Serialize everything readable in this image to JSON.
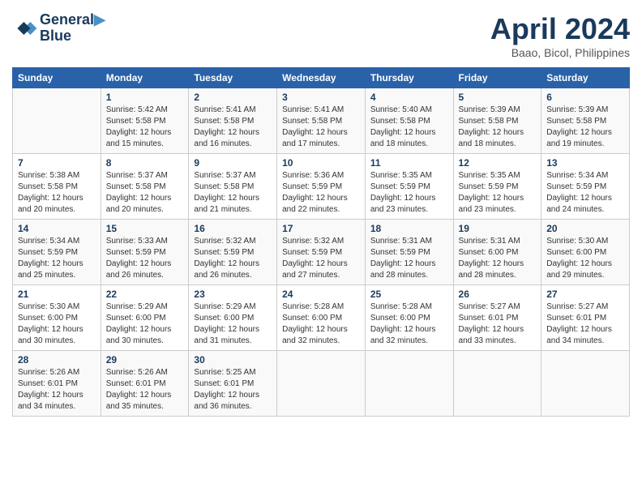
{
  "header": {
    "logo_line1": "General",
    "logo_line2": "Blue",
    "month_title": "April 2024",
    "location": "Baao, Bicol, Philippines"
  },
  "days_of_week": [
    "Sunday",
    "Monday",
    "Tuesday",
    "Wednesday",
    "Thursday",
    "Friday",
    "Saturday"
  ],
  "weeks": [
    [
      {
        "day": "",
        "info": ""
      },
      {
        "day": "1",
        "info": "Sunrise: 5:42 AM\nSunset: 5:58 PM\nDaylight: 12 hours\nand 15 minutes."
      },
      {
        "day": "2",
        "info": "Sunrise: 5:41 AM\nSunset: 5:58 PM\nDaylight: 12 hours\nand 16 minutes."
      },
      {
        "day": "3",
        "info": "Sunrise: 5:41 AM\nSunset: 5:58 PM\nDaylight: 12 hours\nand 17 minutes."
      },
      {
        "day": "4",
        "info": "Sunrise: 5:40 AM\nSunset: 5:58 PM\nDaylight: 12 hours\nand 18 minutes."
      },
      {
        "day": "5",
        "info": "Sunrise: 5:39 AM\nSunset: 5:58 PM\nDaylight: 12 hours\nand 18 minutes."
      },
      {
        "day": "6",
        "info": "Sunrise: 5:39 AM\nSunset: 5:58 PM\nDaylight: 12 hours\nand 19 minutes."
      }
    ],
    [
      {
        "day": "7",
        "info": "Sunrise: 5:38 AM\nSunset: 5:58 PM\nDaylight: 12 hours\nand 20 minutes."
      },
      {
        "day": "8",
        "info": "Sunrise: 5:37 AM\nSunset: 5:58 PM\nDaylight: 12 hours\nand 20 minutes."
      },
      {
        "day": "9",
        "info": "Sunrise: 5:37 AM\nSunset: 5:58 PM\nDaylight: 12 hours\nand 21 minutes."
      },
      {
        "day": "10",
        "info": "Sunrise: 5:36 AM\nSunset: 5:59 PM\nDaylight: 12 hours\nand 22 minutes."
      },
      {
        "day": "11",
        "info": "Sunrise: 5:35 AM\nSunset: 5:59 PM\nDaylight: 12 hours\nand 23 minutes."
      },
      {
        "day": "12",
        "info": "Sunrise: 5:35 AM\nSunset: 5:59 PM\nDaylight: 12 hours\nand 23 minutes."
      },
      {
        "day": "13",
        "info": "Sunrise: 5:34 AM\nSunset: 5:59 PM\nDaylight: 12 hours\nand 24 minutes."
      }
    ],
    [
      {
        "day": "14",
        "info": "Sunrise: 5:34 AM\nSunset: 5:59 PM\nDaylight: 12 hours\nand 25 minutes."
      },
      {
        "day": "15",
        "info": "Sunrise: 5:33 AM\nSunset: 5:59 PM\nDaylight: 12 hours\nand 26 minutes."
      },
      {
        "day": "16",
        "info": "Sunrise: 5:32 AM\nSunset: 5:59 PM\nDaylight: 12 hours\nand 26 minutes."
      },
      {
        "day": "17",
        "info": "Sunrise: 5:32 AM\nSunset: 5:59 PM\nDaylight: 12 hours\nand 27 minutes."
      },
      {
        "day": "18",
        "info": "Sunrise: 5:31 AM\nSunset: 5:59 PM\nDaylight: 12 hours\nand 28 minutes."
      },
      {
        "day": "19",
        "info": "Sunrise: 5:31 AM\nSunset: 6:00 PM\nDaylight: 12 hours\nand 28 minutes."
      },
      {
        "day": "20",
        "info": "Sunrise: 5:30 AM\nSunset: 6:00 PM\nDaylight: 12 hours\nand 29 minutes."
      }
    ],
    [
      {
        "day": "21",
        "info": "Sunrise: 5:30 AM\nSunset: 6:00 PM\nDaylight: 12 hours\nand 30 minutes."
      },
      {
        "day": "22",
        "info": "Sunrise: 5:29 AM\nSunset: 6:00 PM\nDaylight: 12 hours\nand 30 minutes."
      },
      {
        "day": "23",
        "info": "Sunrise: 5:29 AM\nSunset: 6:00 PM\nDaylight: 12 hours\nand 31 minutes."
      },
      {
        "day": "24",
        "info": "Sunrise: 5:28 AM\nSunset: 6:00 PM\nDaylight: 12 hours\nand 32 minutes."
      },
      {
        "day": "25",
        "info": "Sunrise: 5:28 AM\nSunset: 6:00 PM\nDaylight: 12 hours\nand 32 minutes."
      },
      {
        "day": "26",
        "info": "Sunrise: 5:27 AM\nSunset: 6:01 PM\nDaylight: 12 hours\nand 33 minutes."
      },
      {
        "day": "27",
        "info": "Sunrise: 5:27 AM\nSunset: 6:01 PM\nDaylight: 12 hours\nand 34 minutes."
      }
    ],
    [
      {
        "day": "28",
        "info": "Sunrise: 5:26 AM\nSunset: 6:01 PM\nDaylight: 12 hours\nand 34 minutes."
      },
      {
        "day": "29",
        "info": "Sunrise: 5:26 AM\nSunset: 6:01 PM\nDaylight: 12 hours\nand 35 minutes."
      },
      {
        "day": "30",
        "info": "Sunrise: 5:25 AM\nSunset: 6:01 PM\nDaylight: 12 hours\nand 36 minutes."
      },
      {
        "day": "",
        "info": ""
      },
      {
        "day": "",
        "info": ""
      },
      {
        "day": "",
        "info": ""
      },
      {
        "day": "",
        "info": ""
      }
    ]
  ]
}
